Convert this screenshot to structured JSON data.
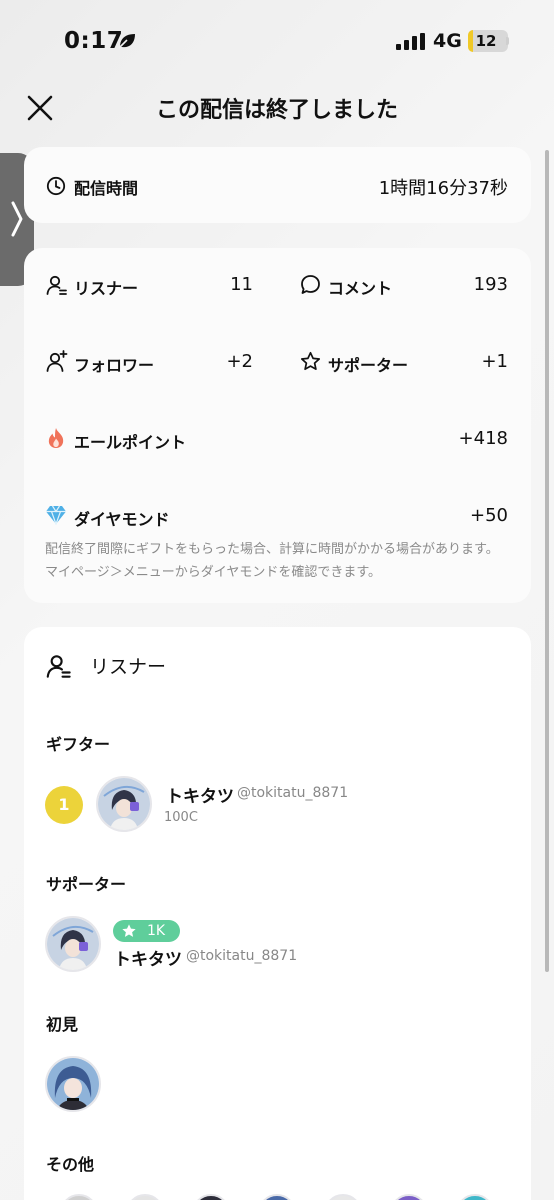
{
  "status_bar": {
    "time": "0:17",
    "network": "4G",
    "battery": "12",
    "battery_level": 0.12
  },
  "header": {
    "title": "この配信は終了しました"
  },
  "duration": {
    "label": "配信時間",
    "value": "1時間16分37秒"
  },
  "stats": {
    "listeners": {
      "label": "リスナー",
      "value": "11"
    },
    "comments": {
      "label": "コメント",
      "value": "193"
    },
    "followers": {
      "label": "フォロワー",
      "value": "+2"
    },
    "supporters": {
      "label": "サポーター",
      "value": "+1"
    },
    "cheer_points": {
      "label": "エールポイント",
      "value": "+418"
    },
    "diamonds": {
      "label": "ダイヤモンド",
      "value": "+50"
    },
    "note": "配信終了間際にギフトをもらった場合、計算に時間がかかる場合があります。マイページ＞メニューからダイヤモンドを確認できます。"
  },
  "listener_section": {
    "title": "リスナー",
    "gifter": {
      "heading": "ギフター",
      "rank": "1",
      "name": "トキタツ",
      "handle": "@tokitatu_8871",
      "coins": "100C"
    },
    "supporter": {
      "heading": "サポーター",
      "badge": "1K",
      "name": "トキタツ",
      "handle": "@tokitatu_8871"
    },
    "first_time": {
      "heading": "初見"
    },
    "other": {
      "heading": "その他"
    }
  },
  "colors": {
    "accent_yellow": "#ecd33a",
    "badge_green": "#5fce9b",
    "fire": "#f0735a",
    "diamond": "#4fb0e6"
  },
  "icons": [
    "leaf-icon",
    "signal-icon",
    "close-icon",
    "chevron-right-icon",
    "clock-icon",
    "person-icon",
    "chat-bubble-icon",
    "person-add-icon",
    "star-icon",
    "fire-icon",
    "diamond-icon"
  ]
}
